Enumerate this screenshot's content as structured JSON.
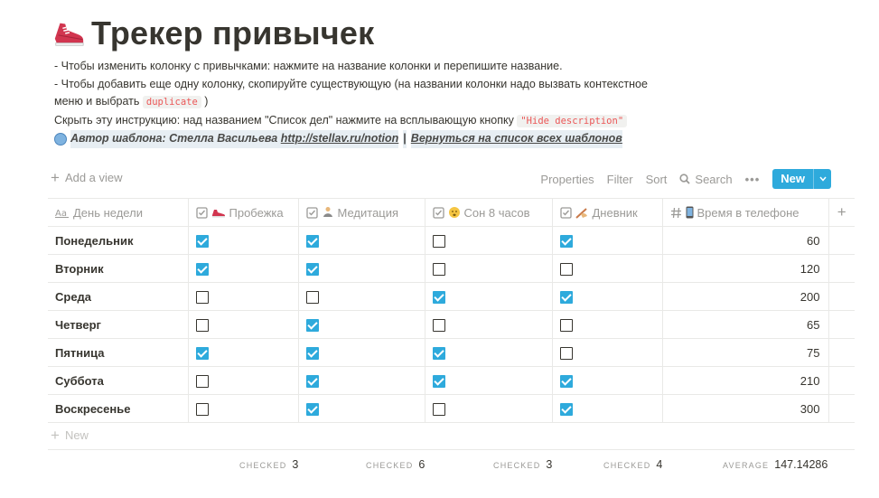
{
  "page": {
    "title": "Трекер привычек",
    "icon": "running-shoe-icon"
  },
  "description": {
    "line1": "- Чтобы изменить колонку с привычками: нажмите на название колонки и перепишите название.",
    "line2a": "- Чтобы добавить еще одну колонку, скопируйте существующую (на названии колонки надо вызвать контекстное",
    "line2b": "меню и выбрать",
    "line2_code": "duplicate",
    "line2_end": ")",
    "line3": "Скрыть эту инструкцию: над названием \"Список дел\" нажмите на всплывающую кнопку",
    "line3_code": "\"Hide description\"",
    "author_label": "Автор шаблона: Стелла Васильева",
    "author_link": "http://stellav.ru/notion",
    "separator": "|",
    "back_link": "Вернуться на список всех шаблонов"
  },
  "viewbar": {
    "add_view": "Add a view",
    "properties": "Properties",
    "filter": "Filter",
    "sort": "Sort",
    "search": "Search",
    "more": "•••",
    "new_label": "New"
  },
  "table": {
    "columns": [
      {
        "label": "День недели",
        "icon": "text-property-icon"
      },
      {
        "label": "Пробежка",
        "icon": "checkbox-property-icon",
        "emoji": "shoe-emoji"
      },
      {
        "label": "Медитация",
        "icon": "checkbox-property-icon",
        "emoji": "meditation-emoji"
      },
      {
        "label": "Сон 8 часов",
        "icon": "checkbox-property-icon",
        "emoji": "sleep-emoji"
      },
      {
        "label": "Дневник",
        "icon": "checkbox-property-icon",
        "emoji": "writing-emoji"
      },
      {
        "label": "Время в телефоне",
        "icon": "number-property-icon",
        "emoji": "phone-emoji"
      }
    ],
    "rows": [
      {
        "day": "Понедельник",
        "checks": [
          true,
          true,
          false,
          true
        ],
        "phone": "60"
      },
      {
        "day": "Вторник",
        "checks": [
          true,
          true,
          false,
          false
        ],
        "phone": "120"
      },
      {
        "day": "Среда",
        "checks": [
          false,
          false,
          true,
          true
        ],
        "phone": "200"
      },
      {
        "day": "Четверг",
        "checks": [
          false,
          true,
          false,
          false
        ],
        "phone": "65"
      },
      {
        "day": "Пятница",
        "checks": [
          true,
          true,
          true,
          false
        ],
        "phone": "75"
      },
      {
        "day": "Суббота",
        "checks": [
          false,
          true,
          true,
          true
        ],
        "phone": "210"
      },
      {
        "day": "Воскресенье",
        "checks": [
          false,
          true,
          false,
          true
        ],
        "phone": "300"
      }
    ],
    "new_row": "New"
  },
  "footer": {
    "calcs": [
      {
        "label": "CHECKED",
        "value": "3"
      },
      {
        "label": "CHECKED",
        "value": "6"
      },
      {
        "label": "CHECKED",
        "value": "3"
      },
      {
        "label": "CHECKED",
        "value": "4"
      },
      {
        "label": "AVERAGE",
        "value": "147.14286"
      }
    ]
  },
  "colors": {
    "accent": "#2eaadc",
    "code_text": "#eb5757",
    "muted": "#9b9a97",
    "text": "#37352f"
  }
}
